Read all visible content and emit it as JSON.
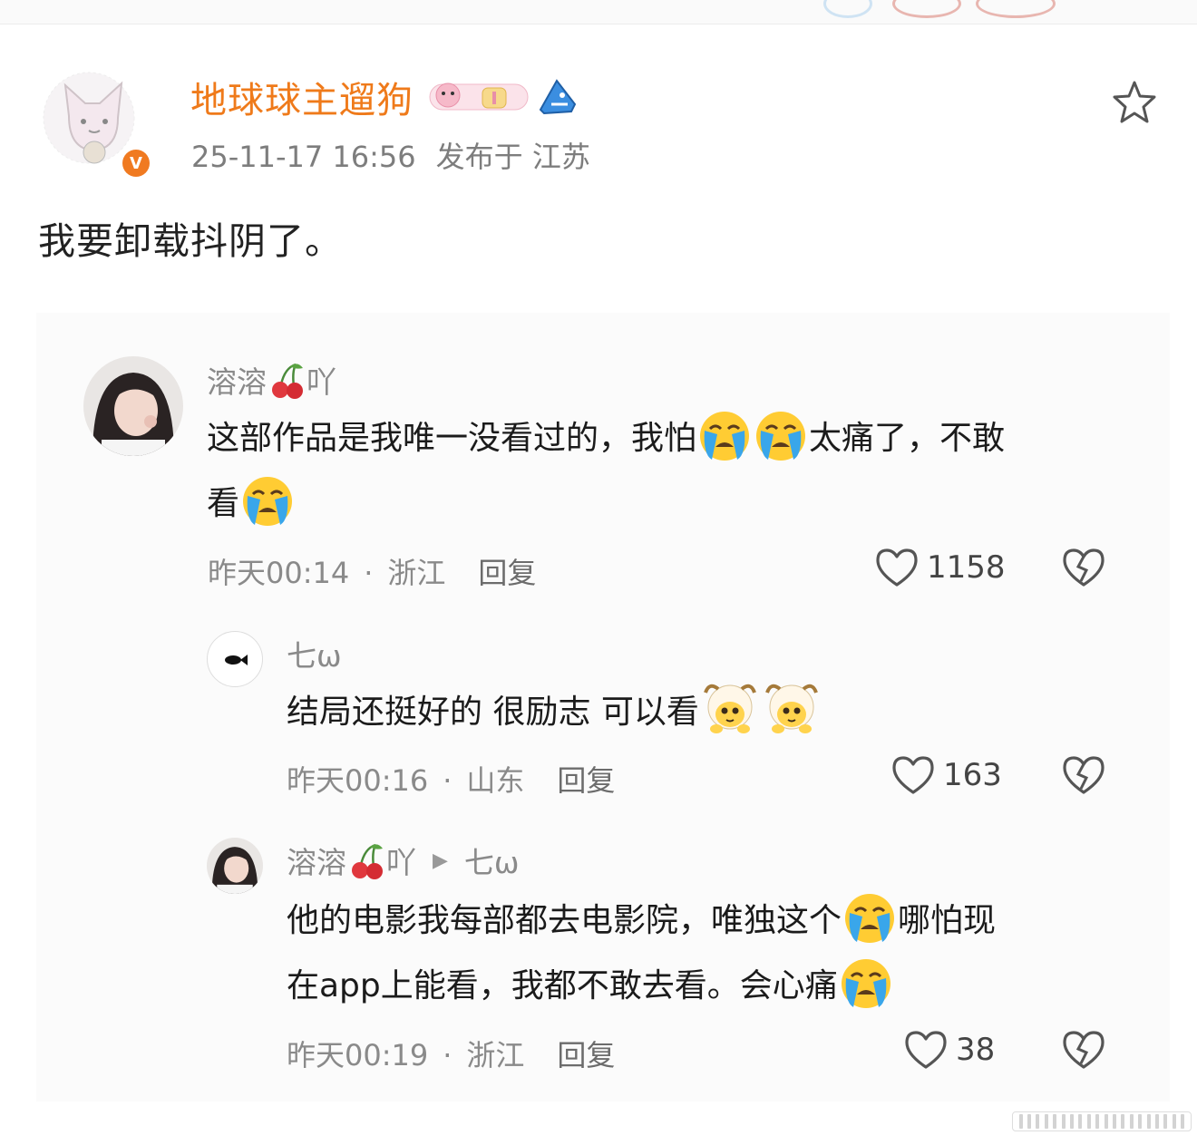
{
  "post": {
    "author_name": "地球球主遛狗",
    "timestamp": "25-11-17 16:56",
    "location": "发布于 江苏",
    "text": "我要卸载抖阴了。",
    "verified_badge": "V"
  },
  "icons": {
    "favorite": "star-outline-icon",
    "like": "heart-outline-icon",
    "dislike": "broken-heart-icon",
    "emoji_cry": "loudly-crying-face-icon",
    "emoji_sheep": "sheep-hopeful-emoji-icon",
    "cherry": "cherry-icon"
  },
  "colors": {
    "author": "#ef7a1a",
    "meta": "#8a8a8a",
    "verified": "#f07a21"
  },
  "comments": [
    {
      "author_prefix": "溶溶",
      "author_suffix": "吖",
      "text_1": "这部作品是我唯一没看过的，我怕",
      "text_2": "太痛了，不敢",
      "text_3": "看",
      "time": "昨天00:14",
      "dot": "·",
      "location": "浙江",
      "reply": "回复",
      "likes": "1158"
    },
    {
      "author": "七ω",
      "text_1": "结局还挺好的 很励志 可以看",
      "time": "昨天00:16",
      "dot": "·",
      "location": "山东",
      "reply": "回复",
      "likes": "163"
    },
    {
      "author_prefix": "溶溶",
      "author_suffix": "吖",
      "reply_to": "七ω",
      "text_1": "他的电影我每部都去电影院，唯独这个",
      "text_2": "哪怕现",
      "text_3": "在app上能看，我都不敢去看。会心痛",
      "time": "昨天00:19",
      "dot": "·",
      "location": "浙江",
      "reply": "回复",
      "likes": "38"
    }
  ]
}
